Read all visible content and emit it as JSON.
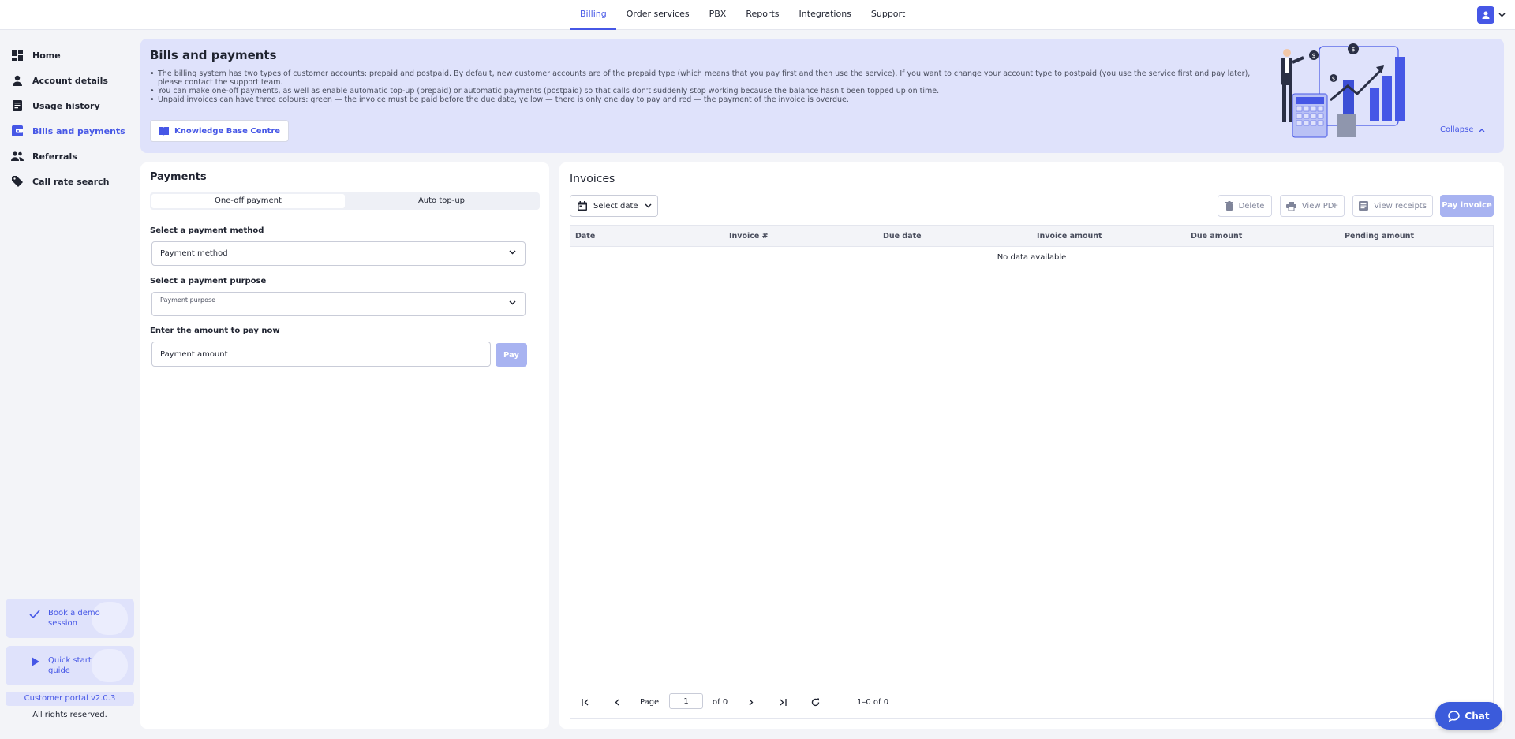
{
  "topnav": {
    "tabs": [
      {
        "label": "Billing",
        "active": true
      },
      {
        "label": "Order services"
      },
      {
        "label": "PBX"
      },
      {
        "label": "Reports"
      },
      {
        "label": "Integrations"
      },
      {
        "label": "Support"
      }
    ]
  },
  "sidebar": {
    "items": [
      {
        "label": "Home",
        "icon": "dashboard-icon"
      },
      {
        "label": "Account details",
        "icon": "person-icon"
      },
      {
        "label": "Usage history",
        "icon": "document-icon"
      },
      {
        "label": "Bills and payments",
        "icon": "wallet-icon",
        "active": true
      },
      {
        "label": "Referrals",
        "icon": "people-icon"
      },
      {
        "label": "Call rate search",
        "icon": "tag-icon"
      }
    ],
    "promo_demo": "Book a demo session",
    "promo_guide": "Quick start guide",
    "version": "Customer portal v2.0.3",
    "rights": "All rights reserved."
  },
  "banner": {
    "title": "Bills and payments",
    "bullets": [
      "The billing system has two types of customer accounts: prepaid and postpaid. By default, new customer accounts are of the prepaid type (which means that you pay first and then use the service). If you want to change your account type to postpaid (you use the service first and pay later), please contact the support team.",
      "You can make one-off payments, as well as enable automatic top-up (prepaid) or automatic payments (postpaid) so that calls don't suddenly stop working because the balance hasn't been topped up on time.",
      "Unpaid invoices can have three colours: green — the invoice must be paid before the due date, yellow — there is only one day to pay and red — the payment of the invoice is overdue."
    ],
    "kb_button": "Knowledge Base Centre",
    "collapse": "Collapse"
  },
  "payments": {
    "title": "Payments",
    "tabs": [
      "One-off payment",
      "Auto top-up"
    ],
    "active_tab": 0,
    "method_label": "Select a payment method",
    "method_value": "Payment method",
    "purpose_label": "Select a payment purpose",
    "purpose_value": "Payment purpose",
    "amount_label": "Enter the amount to pay now",
    "amount_placeholder": "Payment amount",
    "pay_button": "Pay"
  },
  "invoices": {
    "title": "Invoices",
    "date_button": "Select date",
    "delete": "Delete",
    "view_pdf": "View PDF",
    "view_receipts": "View receipts",
    "pay_invoice": "Pay invoice",
    "columns": [
      "Date",
      "Invoice #",
      "Due date",
      "Invoice amount",
      "Due amount",
      "Pending amount"
    ],
    "empty": "No data available",
    "pager": {
      "page_label": "Page",
      "page": "1",
      "of": "of 0",
      "range": "1–0 of 0"
    }
  },
  "chat": "Chat",
  "colors": {
    "accent": "#4657e6",
    "banner_bg": "#dfe2fb",
    "disabled": "#a8b3f1"
  }
}
